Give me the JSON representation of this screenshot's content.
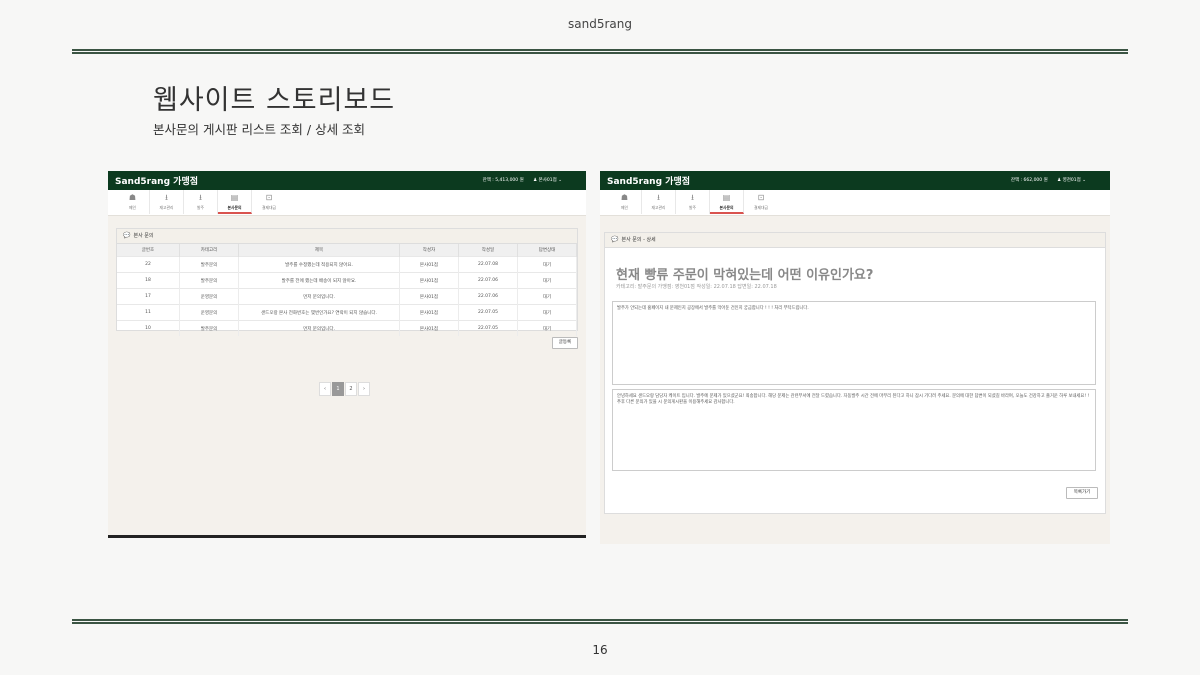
{
  "slide": {
    "header": "sand5rang",
    "title": "웹사이트 스토리보드",
    "subtitle": "본사문의 게시판 리스트 조회 / 상세 조회",
    "page_number": "16"
  },
  "left_screen": {
    "brand": "Sand5rang 가맹점",
    "balance": "잔액 : 5,413,000 원",
    "user": "본사01점",
    "nav": [
      {
        "icon": "home-icon",
        "label": "메인"
      },
      {
        "icon": "download-icon",
        "label": "재고관리"
      },
      {
        "icon": "download-icon",
        "label": "발주"
      },
      {
        "icon": "inquiry-icon",
        "label": "본사문의"
      },
      {
        "icon": "payment-icon",
        "label": "결제대금"
      }
    ],
    "panel_title": "본사 문의",
    "columns": [
      "글번호",
      "카테고리",
      "제목",
      "작성자",
      "작성일",
      "답변상태"
    ],
    "rows": [
      [
        "22",
        "발주문의",
        "발주를 수정했는데 적용되지 않아요.",
        "본사01점",
        "22.07.08",
        "대기"
      ],
      [
        "18",
        "발주문의",
        "발주를 전에 했는데 배송이 되지 않아요.",
        "본사01점",
        "22.07.06",
        "대기"
      ],
      [
        "17",
        "운영문의",
        "먼저 문의입니다.",
        "본사01점",
        "22.07.06",
        "대기"
      ],
      [
        "11",
        "운영문의",
        "샌드오랑 본사 전화번호는 몇번인가요? 연락이 되지 않습니다.",
        "본사01점",
        "22.07.05",
        "대기"
      ],
      [
        "10",
        "발주문의",
        "먼저 문의입니다.",
        "본사01점",
        "22.07.05",
        "대기"
      ]
    ],
    "write_button": "글등록",
    "pager": {
      "prev": "‹",
      "pages": [
        "1",
        "2"
      ],
      "current": "1",
      "next": "›"
    }
  },
  "right_screen": {
    "brand": "Sand5rang 가맹점",
    "balance": "잔액 : 662,000 원",
    "user": "영천01점",
    "nav": [
      {
        "icon": "home-icon",
        "label": "메인"
      },
      {
        "icon": "download-icon",
        "label": "재고관리"
      },
      {
        "icon": "download-icon",
        "label": "발주"
      },
      {
        "icon": "inquiry-icon",
        "label": "본사문의"
      },
      {
        "icon": "payment-icon",
        "label": "결제대금"
      }
    ],
    "panel_title": "본사 문의 - 상세",
    "question_title": "현재 빵류 주문이 막혀있는데 어떤 이유인가요?",
    "meta": "카테고리: 발주문의    가맹점: 영천01점    작성일: 22.07.18    답변일: 22.07.18",
    "question_body": "발주가 안되는데 홈페이지 내 문제인지 공장에서 발주를 막아둔 건인지 궁금합니다 ! ! ! 처리 부탁드립니다.",
    "answer_body": "안녕하세요 샌드오랑 담당자 케이트 입니다. 발주에 문제가 있으셨군요! 죄송합니다. 해당 문제는 관련부서에 전달 드렸습니다. 자동발주 시간 전에 마무리 된다고 하니 잠시 기다려 주세요. 문의에 대한 답변이 되셨길 바라며, 오늘도 건강하고 즐거운 하루 보내세요! ! 추후 다른 문의가 있을 시 문의게시판을 이용해주세요 감사합니다.",
    "list_button": "목록가기"
  }
}
